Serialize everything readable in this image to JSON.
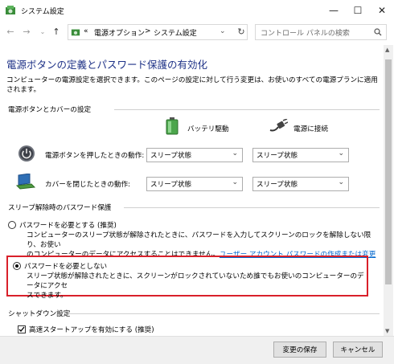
{
  "window": {
    "title": "システム設定"
  },
  "address": {
    "breadcrumb_prefix": "«",
    "crumb1": "電源オプション",
    "separator": ">",
    "crumb2": "システム設定",
    "search_placeholder": "コントロール パネルの検索"
  },
  "main": {
    "heading": "電源ボタンの定義とパスワード保護の有効化",
    "description": "コンピューターの電源設定を選択できます。このページの設定に対して行う変更は、お使いのすべての電源プランに適用されます。",
    "power_section_title": "電源ボタンとカバーの設定",
    "col_battery": "バッテリ駆動",
    "col_plugged": "電源に接続",
    "power_button_label": "電源ボタンを押したときの動作:",
    "lid_label": "カバーを閉じたときの動作:",
    "power_button_battery": "スリープ状態",
    "power_button_plugged": "スリープ状態",
    "lid_battery": "スリープ状態",
    "lid_plugged": "スリープ状態",
    "password_section_title": "スリープ解除時のパスワード保護",
    "option1_label": "パスワードを必要とする (推奨)",
    "option1_desc1": "コンピューターのスリープ状態が解除されたときに、パスワードを入力してスクリーンのロックを解除しない限り、お使い",
    "option1_desc2": "のコンピューターのデータにアクセスすることはできません。",
    "option1_link": "ユーザー アカウント パスワードの作成または変更",
    "option2_label": "パスワードを必要としない",
    "option2_desc1": "スリープ状態が解除されたときに、スクリーンがロックされていないため誰でもお使いのコンピューターのデータにアクセ",
    "option2_desc2": "スできます。",
    "shutdown_section_title": "シャットダウン設定",
    "fast_startup_label": "高速スタートアップを有効にする (推奨)"
  },
  "footer": {
    "save": "変更の保存",
    "cancel": "キャンセル"
  },
  "colors": {
    "heading": "#1e3287",
    "highlight": "#d9202a",
    "link": "#0066cc"
  }
}
